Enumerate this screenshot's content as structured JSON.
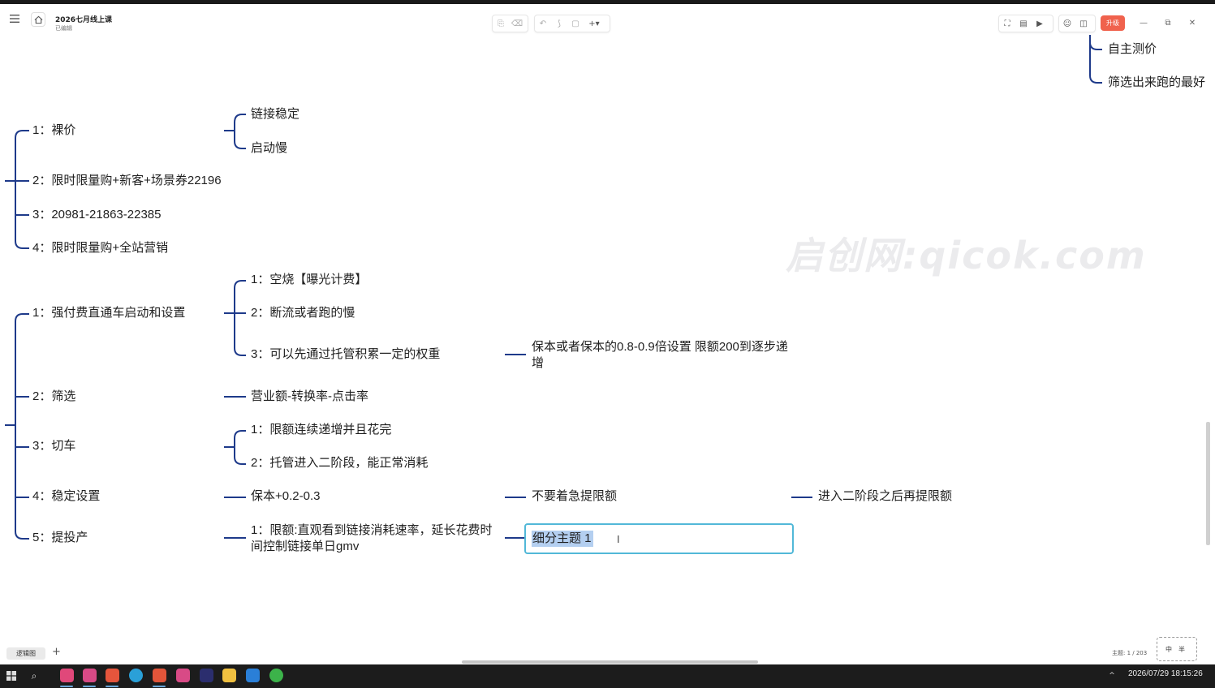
{
  "document": {
    "title": "2026七月线上课",
    "subtitle": "已编辑"
  },
  "header": {
    "upgrade_label": "升级"
  },
  "colors": {
    "line": "#1e3a8a",
    "accent": "#52b8d8",
    "upgrade": "#f0624d"
  },
  "mindmap": {
    "top_right": [
      "自主测价",
      "筛选出来跑的最好"
    ],
    "group1": [
      "1：裸价",
      "2：限时限量购+新客+场景券22196",
      "3：20981-21863-22385",
      "4：限时限量购+全站营销"
    ],
    "group1_children": [
      "链接稳定",
      "启动慢"
    ],
    "group2": [
      "1：强付费直通车启动和设置",
      "2：筛选",
      "3：切车",
      "4：稳定设置",
      "5：提投产"
    ],
    "g2_1_children": [
      "1：空烧【曝光计费】",
      "2：断流或者跑的慢",
      "3：可以先通过托管积累一定的权重"
    ],
    "g2_1_3_child": "保本或者保本的0.8-0.9倍设置  限额200到逐步递增",
    "g2_2_child": "营业额-转换率-点击率",
    "g2_3_children": [
      "1：限额连续递增并且花完",
      "2：托管进入二阶段，能正常消耗"
    ],
    "g2_4_chain": [
      "保本+0.2-0.3",
      "不要着急提限额",
      "进入二阶段之后再提限额"
    ],
    "g2_5_child": "1：限额:直观看到链接消耗速率，延长花费时间控制链接单日gmv",
    "editing_topic": "细分主题 1"
  },
  "watermark": "启创网:qicok.com",
  "bottom": {
    "sheet_tab": "逻辑图",
    "add_label": "+",
    "topic_count": "主题: 1 / 203"
  },
  "ime": {
    "lang": "中",
    "mode": "半"
  },
  "taskbar": {
    "datetime": "2026/07/29 18:15:26"
  }
}
